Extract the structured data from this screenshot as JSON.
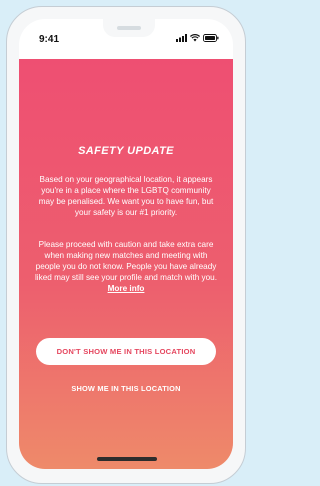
{
  "status_bar": {
    "time": "9:41",
    "icons": [
      "signal-icon",
      "wifi-icon",
      "battery-icon"
    ]
  },
  "colors": {
    "gradient_top": "#ee4f72",
    "gradient_bottom": "#ee8a6a",
    "button_text": "#e5475f",
    "background": "#d9eef8"
  },
  "safety": {
    "title": "SAFETY UPDATE",
    "paragraph1": "Based on your geographical location, it appears you're in a place where the LGBTQ community may be penalised. We want you to have fun, but your safety is our #1 priority.",
    "paragraph2": "Please proceed with caution and take extra care when making new matches and meeting with people you do not know. People you have already liked may still see your profile and match with you.",
    "more_info": "More info"
  },
  "actions": {
    "hide_label": "DON'T SHOW ME IN THIS LOCATION",
    "show_label": "SHOW ME IN THIS LOCATION"
  }
}
